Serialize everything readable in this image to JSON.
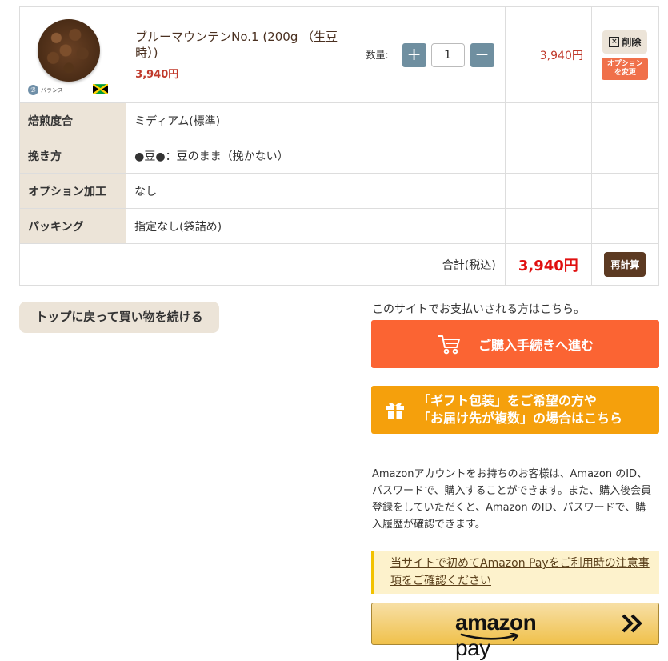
{
  "product": {
    "name": "ブルーマウンテンNo.1 (200g （生豆時）)",
    "price": "3,940円",
    "balance_label": "バランス",
    "balance_icon": "ℬ",
    "quantity_label": "数量:",
    "quantity": "1",
    "line_total": "3,940円",
    "delete_label": "削除",
    "option_change_label": "オプション\nを変更"
  },
  "options": [
    {
      "label": "焙煎度合",
      "value": "ミディアム(標準)"
    },
    {
      "label": "挽き方",
      "value": "●豆●：豆のまま（挽かない）"
    },
    {
      "label": "オプション加工",
      "value": "なし"
    },
    {
      "label": "パッキング",
      "value": "指定なし(袋詰め)"
    }
  ],
  "totals": {
    "label": "合計(税込)",
    "value": "3,940円",
    "recalc_label": "再計算"
  },
  "continue_label": "トップに戻って買い物を続ける",
  "payment": {
    "note": "このサイトでお支払いされる方はこちら。",
    "checkout_label": "ご購入手続きへ進む",
    "gift_line1": "「ギフト包装」をご希望の方や",
    "gift_line2": "「お届け先が複数」の場合はこちら"
  },
  "amazon": {
    "info": "Amazonアカウントをお持ちのお客様は、Amazon のID、パスワードで、購入することができます。また、購入後会員登録をしていただくと、Amazon のID、パスワードで、購入履歴が確認できます。",
    "warning_link": "当サイトで初めてAmazon Payをご利用時の注意事項をご確認ください",
    "pay_word1": "amazon",
    "pay_word2": "pay"
  },
  "colors": {
    "checkout": "#fb6433",
    "gift": "#f5a00c",
    "price_red": "#e01010",
    "label_bg": "#ece4d8",
    "qty_button": "#6f8fa0",
    "recalc": "#5c3a22"
  }
}
